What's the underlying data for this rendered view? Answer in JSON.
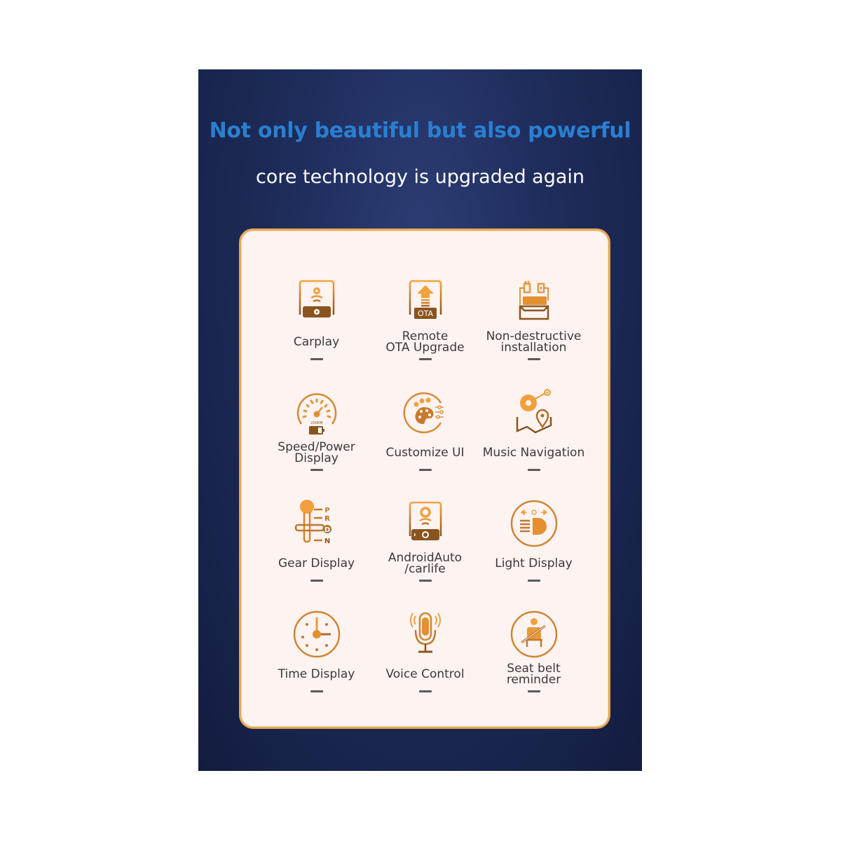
{
  "header": {
    "headline": "Not only beautiful but also powerful",
    "subheadline": "core technology is upgraded again"
  },
  "colors": {
    "headline": "#2a7fd0",
    "accent_orange": "#f0a03c",
    "accent_brown": "#8a5420",
    "card_border": "#e4a756",
    "card_bg": "#fdf3f0",
    "background": "#1f2d5c"
  },
  "features": [
    {
      "label": "Carplay",
      "icon": "carplay-icon"
    },
    {
      "label": "Remote\nOTA Upgrade",
      "icon": "ota-upgrade-icon",
      "badge": "OTA"
    },
    {
      "label": "Non-destructive\ninstallation",
      "icon": "plug-installation-icon"
    },
    {
      "label": "Speed/Power\nDisplay",
      "icon": "speedometer-icon",
      "gauge_text": "200KM"
    },
    {
      "label": "Customize UI",
      "icon": "palette-icon"
    },
    {
      "label": "Music Navigation",
      "icon": "music-navigation-icon"
    },
    {
      "label": "Gear Display",
      "icon": "gear-shift-icon",
      "gears": [
        "P",
        "R",
        "D",
        "N"
      ]
    },
    {
      "label": "AndroidAuto\n/carlife",
      "icon": "android-auto-icon"
    },
    {
      "label": "Light Display",
      "icon": "headlight-icon"
    },
    {
      "label": "Time Display",
      "icon": "clock-icon"
    },
    {
      "label": "Voice Control",
      "icon": "microphone-icon"
    },
    {
      "label": "Seat belt reminder",
      "icon": "seatbelt-icon"
    }
  ]
}
